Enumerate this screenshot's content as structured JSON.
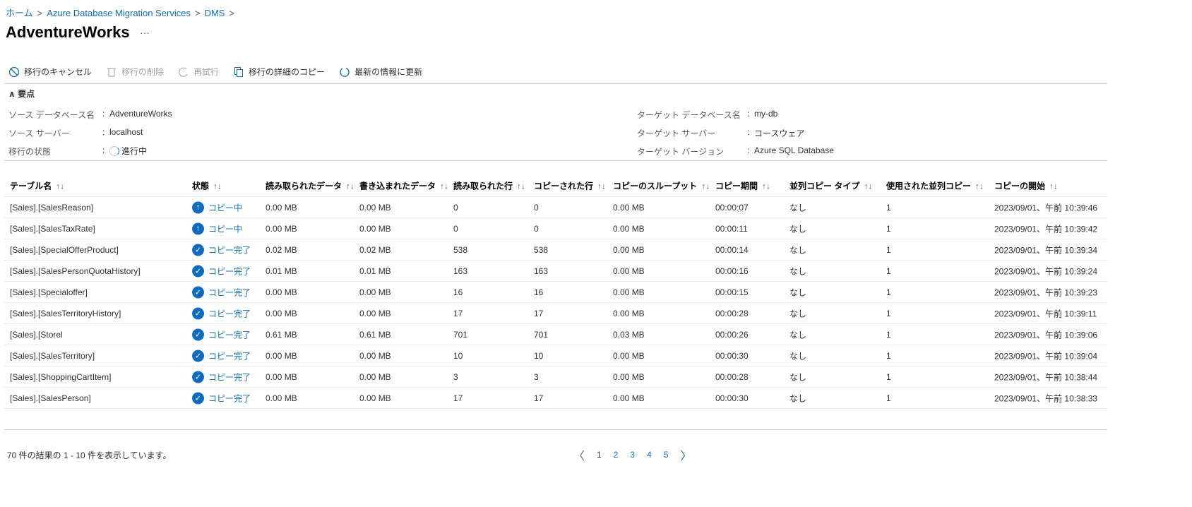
{
  "breadcrumb": [
    "ホーム",
    "Azure Database Migration Services",
    "DMS"
  ],
  "title": "AdventureWorks",
  "more": "···",
  "toolbar": {
    "cancel": "移行のキャンセル",
    "delete": "移行の削除",
    "retry": "再試行",
    "copy": "移行の詳細のコピー",
    "refresh": "最新の情報に更新"
  },
  "essentials": {
    "header": "要点",
    "left": [
      {
        "label": "ソース データベース名",
        "value": "AdventureWorks"
      },
      {
        "label": "ソース サーバー",
        "value": "localhost"
      },
      {
        "label": "移行の状態",
        "value": "進行中"
      }
    ],
    "right": [
      {
        "label": "ターゲット データベース名",
        "value": "my-db"
      },
      {
        "label": "ターゲット サーバー",
        "value": "コースウェア"
      },
      {
        "label": "ターゲット バージョン",
        "value": "Azure SQL Database"
      }
    ]
  },
  "columns": [
    "テーブル名",
    "状態",
    "読み取られたデータ",
    "書き込まれたデータ",
    "読み取られた行",
    "コピーされた行",
    "コピーのスループット",
    "コピー期間",
    "並列コピー タイプ",
    "使用された並列コピー",
    "コピーの開始"
  ],
  "sort_icon": "↑↓",
  "rows": [
    [
      "[Sales].[SalesReason]",
      "コピー中",
      "0.00 MB",
      "0.00 MB",
      "0",
      "0",
      "0.00 MB",
      "00:00:07",
      "なし",
      "1",
      "2023/09/01、午前 10:39:46"
    ],
    [
      "[Sales].[SalesTaxRate]",
      "コピー中",
      "0.00 MB",
      "0.00 MB",
      "0",
      "0",
      "0.00 MB",
      "00:00:11",
      "なし",
      "1",
      "2023/09/01、午前 10:39:42"
    ],
    [
      "[Sales].[SpecialOfferProduct]",
      "コピー完了",
      "0.02 MB",
      "0.02 MB",
      "538",
      "538",
      "0.00 MB",
      "00:00:14",
      "なし",
      "1",
      "2023/09/01、午前 10:39:34"
    ],
    [
      "[Sales].[SalesPersonQuotaHistory]",
      "コピー完了",
      "0.01 MB",
      "0.01 MB",
      "163",
      "163",
      "0.00 MB",
      "00:00:16",
      "なし",
      "1",
      "2023/09/01、午前 10:39:24"
    ],
    [
      "[Sales].[Specialoffer]",
      "コピー完了",
      "0.00 MB",
      "0.00 MB",
      "16",
      "16",
      "0.00 MB",
      "00:00:15",
      "なし",
      "1",
      "2023/09/01、午前 10:39:23"
    ],
    [
      "[Sales].[SalesTerritoryHistory]",
      "コピー完了",
      "0.00 MB",
      "0.00 MB",
      "17",
      "17",
      "0.00 MB",
      "00:00:28",
      "なし",
      "1",
      "2023/09/01、午前 10:39:11"
    ],
    [
      "[Sales].[Storel",
      "コピー完了",
      "0.61 MB",
      "0.61 MB",
      "701",
      "701",
      "0.03 MB",
      "00:00:26",
      "なし",
      "1",
      "2023/09/01、午前 10:39:06"
    ],
    [
      "[Sales].[SalesTerritory]",
      "コピー完了",
      "0.00 MB",
      "0.00 MB",
      "10",
      "10",
      "0.00 MB",
      "00:00:30",
      "なし",
      "1",
      "2023/09/01、午前 10:39:04"
    ],
    [
      "[Sales].[ShoppingCartItem]",
      "コピー完了",
      "0.00 MB",
      "0.00 MB",
      "3",
      "3",
      "0.00 MB",
      "00:00:28",
      "なし",
      "1",
      "2023/09/01、午前 10:38:44"
    ],
    [
      "[Sales].[SalesPerson]",
      "コピー完了",
      "0.00 MB",
      "0.00 MB",
      "17",
      "17",
      "0.00 MB",
      "00:00:30",
      "なし",
      "1",
      "2023/09/01、午前 10:38:33"
    ]
  ],
  "footer": "70 件の結果の 1 - 10 件を表示しています。",
  "pagination": {
    "prev": "〈",
    "pages": [
      "1",
      "2",
      "3",
      "4",
      "5"
    ],
    "next": "〉"
  }
}
